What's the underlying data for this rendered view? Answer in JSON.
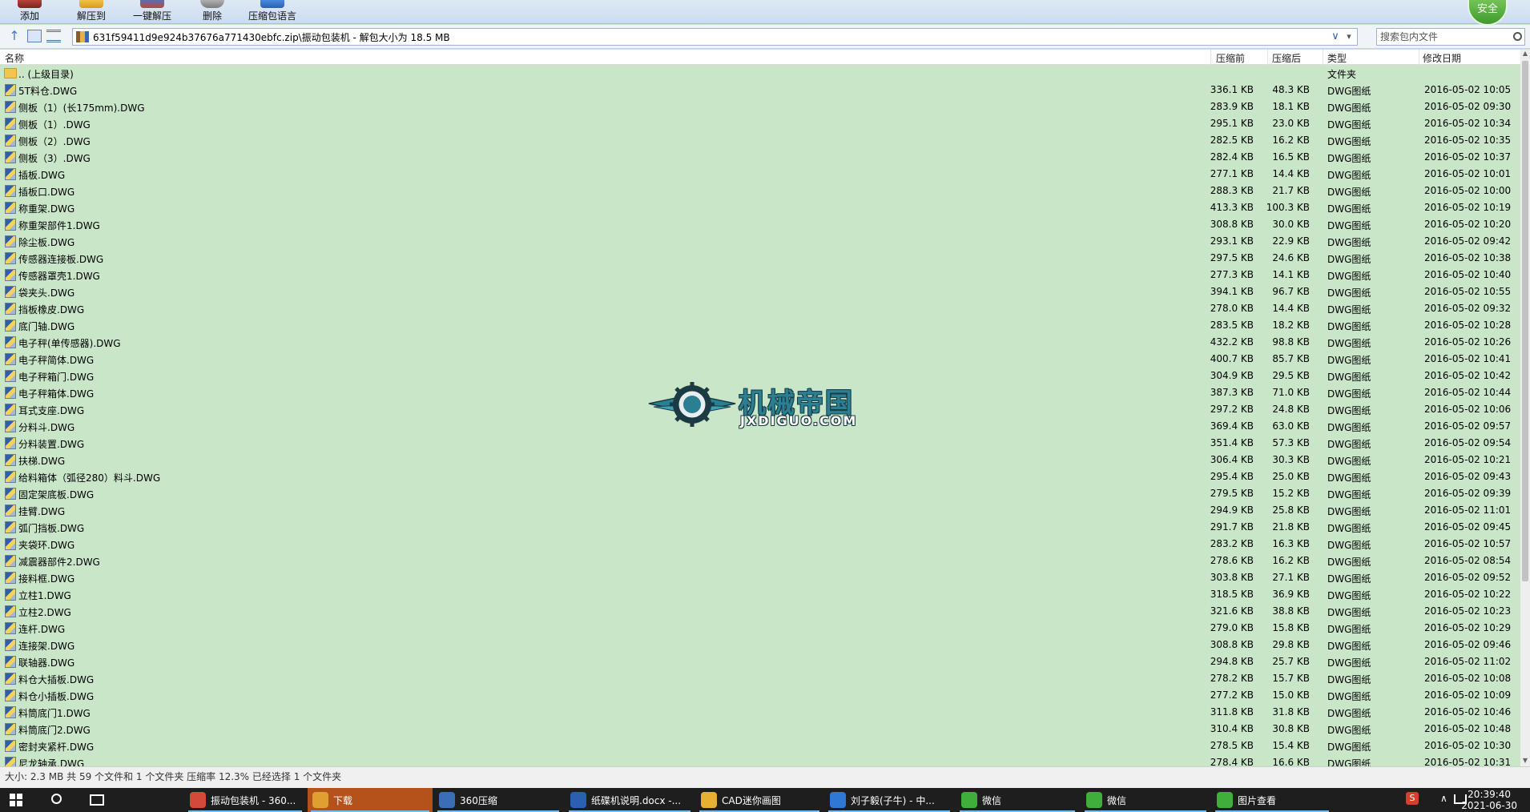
{
  "toolbar": {
    "buttons": [
      {
        "label": "添加",
        "icon": "add-archive-icon"
      },
      {
        "label": "解压到",
        "icon": "extract-to-icon"
      },
      {
        "label": "一键解压",
        "icon": "one-click-extract-icon"
      },
      {
        "label": "删除",
        "icon": "delete-icon"
      },
      {
        "label": "压缩包语言",
        "icon": "archive-language-icon"
      }
    ],
    "badge": "安全"
  },
  "address": {
    "path": "631f59411d9e924b37676a771430ebfc.zip\\振动包装机 - 解包大小为 18.5 MB",
    "search_placeholder": "搜索包内文件"
  },
  "columns": {
    "name": "名称",
    "before": "压缩前",
    "after": "压缩后",
    "type": "类型",
    "date": "修改日期"
  },
  "parent_row": {
    "name": ".. (上级目录)",
    "type": "文件夹"
  },
  "files": [
    {
      "name": "5T料仓.DWG",
      "before": "336.1 KB",
      "after": "48.3 KB",
      "type": "DWG图纸",
      "date": "2016-05-02 10:05"
    },
    {
      "name": "侧板（1）(长175mm).DWG",
      "before": "283.9 KB",
      "after": "18.1 KB",
      "type": "DWG图纸",
      "date": "2016-05-02 09:30"
    },
    {
      "name": "侧板（1）.DWG",
      "before": "295.1 KB",
      "after": "23.0 KB",
      "type": "DWG图纸",
      "date": "2016-05-02 10:34"
    },
    {
      "name": "侧板（2）.DWG",
      "before": "282.5 KB",
      "after": "16.2 KB",
      "type": "DWG图纸",
      "date": "2016-05-02 10:35"
    },
    {
      "name": "侧板（3）.DWG",
      "before": "282.4 KB",
      "after": "16.5 KB",
      "type": "DWG图纸",
      "date": "2016-05-02 10:37"
    },
    {
      "name": "插板.DWG",
      "before": "277.1 KB",
      "after": "14.4 KB",
      "type": "DWG图纸",
      "date": "2016-05-02 10:01"
    },
    {
      "name": "插板口.DWG",
      "before": "288.3 KB",
      "after": "21.7 KB",
      "type": "DWG图纸",
      "date": "2016-05-02 10:00"
    },
    {
      "name": "称重架.DWG",
      "before": "413.3 KB",
      "after": "100.3 KB",
      "type": "DWG图纸",
      "date": "2016-05-02 10:19"
    },
    {
      "name": "称重架部件1.DWG",
      "before": "308.8 KB",
      "after": "30.0 KB",
      "type": "DWG图纸",
      "date": "2016-05-02 10:20"
    },
    {
      "name": "除尘板.DWG",
      "before": "293.1 KB",
      "after": "22.9 KB",
      "type": "DWG图纸",
      "date": "2016-05-02 09:42"
    },
    {
      "name": "传感器连接板.DWG",
      "before": "297.5 KB",
      "after": "24.6 KB",
      "type": "DWG图纸",
      "date": "2016-05-02 10:38"
    },
    {
      "name": "传感器罩壳1.DWG",
      "before": "277.3 KB",
      "after": "14.1 KB",
      "type": "DWG图纸",
      "date": "2016-05-02 10:40"
    },
    {
      "name": "袋夹头.DWG",
      "before": "394.1 KB",
      "after": "96.7 KB",
      "type": "DWG图纸",
      "date": "2016-05-02 10:55"
    },
    {
      "name": "挡板橡皮.DWG",
      "before": "278.0 KB",
      "after": "14.4 KB",
      "type": "DWG图纸",
      "date": "2016-05-02 09:32"
    },
    {
      "name": "底门轴.DWG",
      "before": "283.5 KB",
      "after": "18.2 KB",
      "type": "DWG图纸",
      "date": "2016-05-02 10:28"
    },
    {
      "name": "电子秤(单传感器).DWG",
      "before": "432.2 KB",
      "after": "98.8 KB",
      "type": "DWG图纸",
      "date": "2016-05-02 10:26"
    },
    {
      "name": "电子秤简体.DWG",
      "before": "400.7 KB",
      "after": "85.7 KB",
      "type": "DWG图纸",
      "date": "2016-05-02 10:41"
    },
    {
      "name": "电子秤箱门.DWG",
      "before": "304.9 KB",
      "after": "29.5 KB",
      "type": "DWG图纸",
      "date": "2016-05-02 10:42"
    },
    {
      "name": "电子秤箱体.DWG",
      "before": "387.3 KB",
      "after": "71.0 KB",
      "type": "DWG图纸",
      "date": "2016-05-02 10:44"
    },
    {
      "name": "耳式支座.DWG",
      "before": "297.2 KB",
      "after": "24.8 KB",
      "type": "DWG图纸",
      "date": "2016-05-02 10:06"
    },
    {
      "name": "分料斗.DWG",
      "before": "369.4 KB",
      "after": "63.0 KB",
      "type": "DWG图纸",
      "date": "2016-05-02 09:57"
    },
    {
      "name": "分料装置.DWG",
      "before": "351.4 KB",
      "after": "57.3 KB",
      "type": "DWG图纸",
      "date": "2016-05-02 09:54"
    },
    {
      "name": "扶梯.DWG",
      "before": "306.4 KB",
      "after": "30.3 KB",
      "type": "DWG图纸",
      "date": "2016-05-02 10:21"
    },
    {
      "name": "给料箱体（弧径280）料斗.DWG",
      "before": "295.4 KB",
      "after": "25.0 KB",
      "type": "DWG图纸",
      "date": "2016-05-02 09:43"
    },
    {
      "name": "固定架底板.DWG",
      "before": "279.5 KB",
      "after": "15.2 KB",
      "type": "DWG图纸",
      "date": "2016-05-02 09:39"
    },
    {
      "name": "挂臂.DWG",
      "before": "294.9 KB",
      "after": "25.8 KB",
      "type": "DWG图纸",
      "date": "2016-05-02 11:01"
    },
    {
      "name": "弧门挡板.DWG",
      "before": "291.7 KB",
      "after": "21.8 KB",
      "type": "DWG图纸",
      "date": "2016-05-02 09:45"
    },
    {
      "name": "夹袋环.DWG",
      "before": "283.2 KB",
      "after": "16.3 KB",
      "type": "DWG图纸",
      "date": "2016-05-02 10:57"
    },
    {
      "name": "减震器部件2.DWG",
      "before": "278.6 KB",
      "after": "16.2 KB",
      "type": "DWG图纸",
      "date": "2016-05-02 08:54"
    },
    {
      "name": "接料框.DWG",
      "before": "303.8 KB",
      "after": "27.1 KB",
      "type": "DWG图纸",
      "date": "2016-05-02 09:52"
    },
    {
      "name": "立柱1.DWG",
      "before": "318.5 KB",
      "after": "36.9 KB",
      "type": "DWG图纸",
      "date": "2016-05-02 10:22"
    },
    {
      "name": "立柱2.DWG",
      "before": "321.6 KB",
      "after": "38.8 KB",
      "type": "DWG图纸",
      "date": "2016-05-02 10:23"
    },
    {
      "name": "连杆.DWG",
      "before": "279.0 KB",
      "after": "15.8 KB",
      "type": "DWG图纸",
      "date": "2016-05-02 10:29"
    },
    {
      "name": "连接架.DWG",
      "before": "308.8 KB",
      "after": "29.8 KB",
      "type": "DWG图纸",
      "date": "2016-05-02 09:46"
    },
    {
      "name": "联轴器.DWG",
      "before": "294.8 KB",
      "after": "25.7 KB",
      "type": "DWG图纸",
      "date": "2016-05-02 11:02"
    },
    {
      "name": "料仓大插板.DWG",
      "before": "278.2 KB",
      "after": "15.7 KB",
      "type": "DWG图纸",
      "date": "2016-05-02 10:08"
    },
    {
      "name": "料仓小插板.DWG",
      "before": "277.2 KB",
      "after": "15.0 KB",
      "type": "DWG图纸",
      "date": "2016-05-02 10:09"
    },
    {
      "name": "料筒底门1.DWG",
      "before": "311.8 KB",
      "after": "31.8 KB",
      "type": "DWG图纸",
      "date": "2016-05-02 10:46"
    },
    {
      "name": "料筒底门2.DWG",
      "before": "310.4 KB",
      "after": "30.8 KB",
      "type": "DWG图纸",
      "date": "2016-05-02 10:48"
    },
    {
      "name": "密封夹紧杆.DWG",
      "before": "278.5 KB",
      "after": "15.4 KB",
      "type": "DWG图纸",
      "date": "2016-05-02 10:30"
    },
    {
      "name": "尼龙轴承.DWG",
      "before": "278.4 KB",
      "after": "16.6 KB",
      "type": "DWG图纸",
      "date": "2016-05-02 10:31"
    }
  ],
  "watermark": {
    "title": "机械帝国",
    "subtitle": "JXDIGUO.COM"
  },
  "status": "大小: 2.3 MB 共 59 个文件和 1 个文件夹 压缩率 12.3% 已经选择 1 个文件夹",
  "taskbar": {
    "tasks": [
      {
        "label": "振动包装机 - 360...",
        "icon": "chrome-icon",
        "color": "#d44a3a"
      },
      {
        "label": "下载",
        "icon": "chrome-icon",
        "color": "#e0a030",
        "active": true
      },
      {
        "label": "360压缩",
        "icon": "archive-app-icon",
        "color": "#3a6fb8"
      },
      {
        "label": "纸碟机说明.docx -...",
        "icon": "word-doc-icon",
        "color": "#2b5fb0"
      },
      {
        "label": "CAD迷你画图",
        "icon": "cad-app-icon",
        "color": "#e8b030"
      },
      {
        "label": "刘子毅(子牛) - 中...",
        "icon": "kugou-app-icon",
        "color": "#2f78d6"
      },
      {
        "label": "微信",
        "icon": "wechat-icon",
        "color": "#3fae3a"
      },
      {
        "label": "微信",
        "icon": "wechat-icon",
        "color": "#3fae3a"
      },
      {
        "label": "图片查看",
        "icon": "wechat-icon",
        "color": "#3fae3a"
      }
    ],
    "tray_360": "S",
    "time": "20:39:40",
    "date": "2021-06-30"
  }
}
